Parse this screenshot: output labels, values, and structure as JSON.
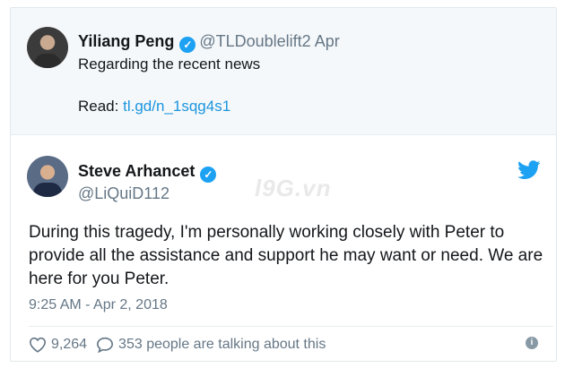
{
  "parent_tweet": {
    "name": "Yiliang Peng",
    "handle_date": "@TLDoublelift2 Apr",
    "text": "Regarding the recent news",
    "read_label": "Read:",
    "read_link": "tl.gd/n_1sqg4s1"
  },
  "tweet": {
    "name": "Steve Arhancet",
    "handle": "@LiQuiD112",
    "body": "During this tragedy, I'm personally working closely with Peter to provide all the assistance and support he may want or need. We are here for you Peter.",
    "timestamp": "9:25 AM - Apr 2, 2018",
    "likes": "9,264",
    "talking": "353 people are talking about this"
  },
  "watermark": "l9G.vn",
  "icons": {
    "verified": "verified-badge-icon",
    "twitter": "twitter-bird-icon",
    "like": "heart-icon",
    "reply": "speech-bubble-icon",
    "info": "info-icon"
  },
  "colors": {
    "accent": "#1da1f2",
    "link": "#1b95e0",
    "muted": "#657786",
    "quoted_bg": "#f5f8fa"
  }
}
